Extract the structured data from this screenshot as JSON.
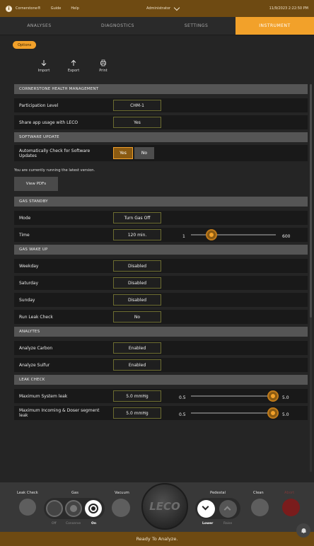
{
  "topbar": {
    "app_name": "Cornerstone®",
    "links": [
      "Guide",
      "Help"
    ],
    "user": "Administrator",
    "datetime": "11/9/2023 2:22:50 PM"
  },
  "tabs": [
    {
      "label": "ANALYSES",
      "active": false
    },
    {
      "label": "DIAGNOSTICS",
      "active": false
    },
    {
      "label": "SETTINGS",
      "active": false
    },
    {
      "label": "INSTRUMENT",
      "active": true
    }
  ],
  "options_label": "Options",
  "toolbar": {
    "import_label": "Import",
    "export_label": "Export",
    "print_label": "Print"
  },
  "health": {
    "header": "CORNERSTONE HEALTH MANAGEMENT",
    "participation_label": "Participation Level",
    "participation_value": "CHM-1",
    "share_label": "Share app usage with LECO",
    "share_value": "Yes"
  },
  "software": {
    "header": "SOFTWARE UPDATE",
    "auto_check_label": "Automatically Check for Software Updates",
    "yes_label": "Yes",
    "no_label": "No",
    "selected": "Yes",
    "status_note": "You are currently running the latest version.",
    "view_pdfs_label": "View PDFs"
  },
  "gas_standby": {
    "header": "GAS STANDBY",
    "mode_label": "Mode",
    "mode_value": "Turn Gas Off",
    "time_label": "Time",
    "time_value": "120 min.",
    "time_min": "1",
    "time_max": "600",
    "time_fraction": 0.2
  },
  "gas_wakeup": {
    "header": "GAS WAKE UP",
    "weekday_label": "Weekday",
    "weekday_value": "Disabled",
    "saturday_label": "Saturday",
    "saturday_value": "Disabled",
    "sunday_label": "Sunday",
    "sunday_value": "Disabled",
    "leak_check_label": "Run Leak Check",
    "leak_check_value": "No"
  },
  "analytes": {
    "header": "ANALYTES",
    "carbon_label": "Analyze Carbon",
    "carbon_value": "Enabled",
    "sulfur_label": "Analyze Sulfur",
    "sulfur_value": "Enabled"
  },
  "leak_check": {
    "header": "LEAK CHECK",
    "system_label": "Maximum System leak",
    "system_value": "5.0 mmHg",
    "system_min": "0.5",
    "system_max": "5.0",
    "system_fraction": 1.0,
    "incoming_label": "Maximum Incoming & Doser segment leak",
    "incoming_value": "5.0 mmHg",
    "incoming_min": "0.5",
    "incoming_max": "5.0",
    "incoming_fraction": 1.0
  },
  "controls": {
    "leak_check": "Leak Check",
    "gas": "Gas",
    "gas_off": "Off",
    "gas_conserve": "Conserve",
    "gas_on": "On",
    "gas_selected": "On",
    "vacuum": "Vacuum",
    "leco_logo": "LECO",
    "pedestal": "Pedestal",
    "pedestal_lower": "Lower",
    "pedestal_raise": "Raise",
    "clean": "Clean",
    "abort": "Abort"
  },
  "status": "Ready To Analyze.",
  "colors": {
    "accent": "#f2a12a",
    "bar": "#6e4a12",
    "abort": "#7a1c1c"
  }
}
